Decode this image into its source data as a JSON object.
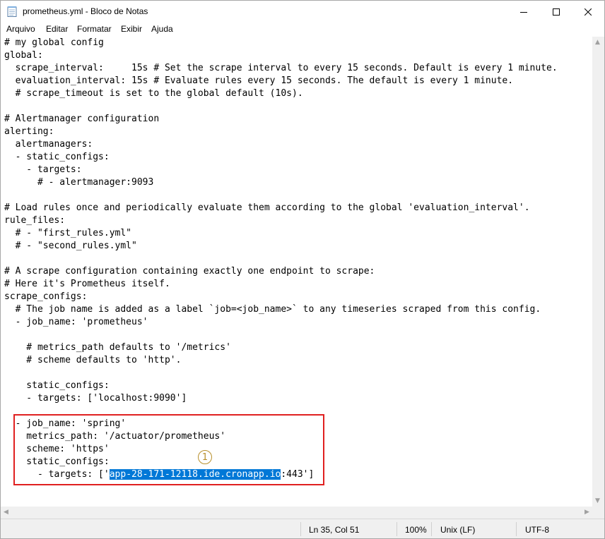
{
  "window": {
    "title": "prometheus.yml - Bloco de Notas",
    "icon": "notepad-icon"
  },
  "menu": [
    "Arquivo",
    "Editar",
    "Formatar",
    "Exibir",
    "Ajuda"
  ],
  "editor": {
    "lines": [
      "# my global config",
      "global:",
      "  scrape_interval:     15s # Set the scrape interval to every 15 seconds. Default is every 1 minute.",
      "  evaluation_interval: 15s # Evaluate rules every 15 seconds. The default is every 1 minute.",
      "  # scrape_timeout is set to the global default (10s).",
      "",
      "# Alertmanager configuration",
      "alerting:",
      "  alertmanagers:",
      "  - static_configs:",
      "    - targets:",
      "      # - alertmanager:9093",
      "",
      "# Load rules once and periodically evaluate them according to the global 'evaluation_interval'.",
      "rule_files:",
      "  # - \"first_rules.yml\"",
      "  # - \"second_rules.yml\"",
      "",
      "# A scrape configuration containing exactly one endpoint to scrape:",
      "# Here it's Prometheus itself.",
      "scrape_configs:",
      "  # The job name is added as a label `job=<job_name>` to any timeseries scraped from this config.",
      "  - job_name: 'prometheus'",
      "",
      "    # metrics_path defaults to '/metrics'",
      "    # scheme defaults to 'http'.",
      "",
      "    static_configs:",
      "    - targets: ['localhost:9090']",
      "",
      "  - job_name: 'spring'",
      "    metrics_path: '/actuator/prometheus'",
      "    scheme: 'https'",
      "    static_configs:"
    ],
    "last_line": {
      "prefix": "      - targets: ['",
      "selected": "app-28-171-12118.ide.cronapp.io",
      "suffix": ":443']"
    }
  },
  "annotation": {
    "callout_number": "1",
    "box_color": "#e02020",
    "callout_color": "#b8902c"
  },
  "statusbar": {
    "position": "Ln 35, Col 51",
    "zoom": "100%",
    "line_ending": "Unix (LF)",
    "encoding": "UTF-8"
  },
  "colors": {
    "selection": "#0078d7"
  }
}
